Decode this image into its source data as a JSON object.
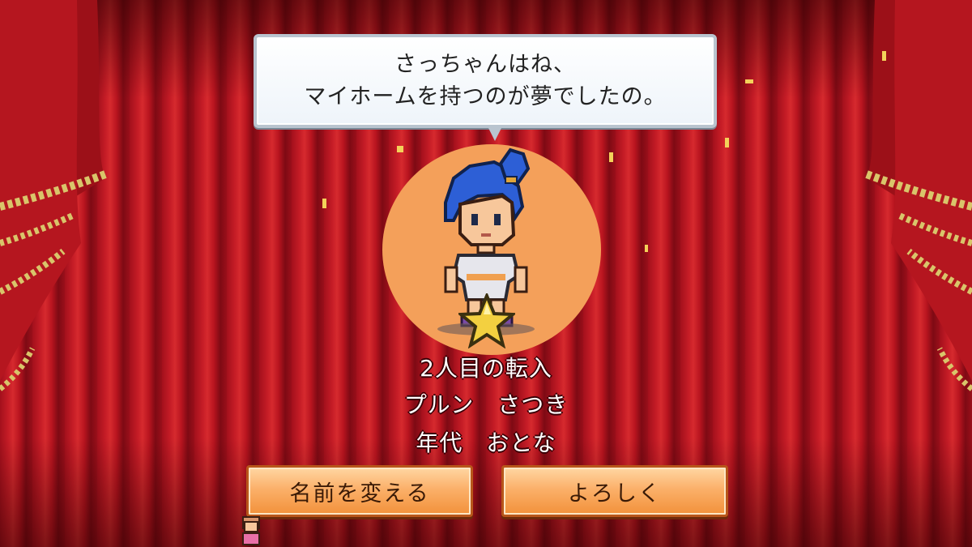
{
  "speech": {
    "line1": "さっちゃんはね、",
    "line2": "マイホームを持つのが夢でしたの。"
  },
  "resident": {
    "arrival": "2人目の転入",
    "name": "プルン　さつき",
    "age": "年代　おとな"
  },
  "buttons": {
    "rename_label": "名前を変える",
    "ok_label": "よろしく"
  },
  "colors": {
    "curtain": "#c51c26",
    "halo": "#f4a05a",
    "button": "#f2913a",
    "hair": "#2d5fd6",
    "star": "#f3d040"
  }
}
